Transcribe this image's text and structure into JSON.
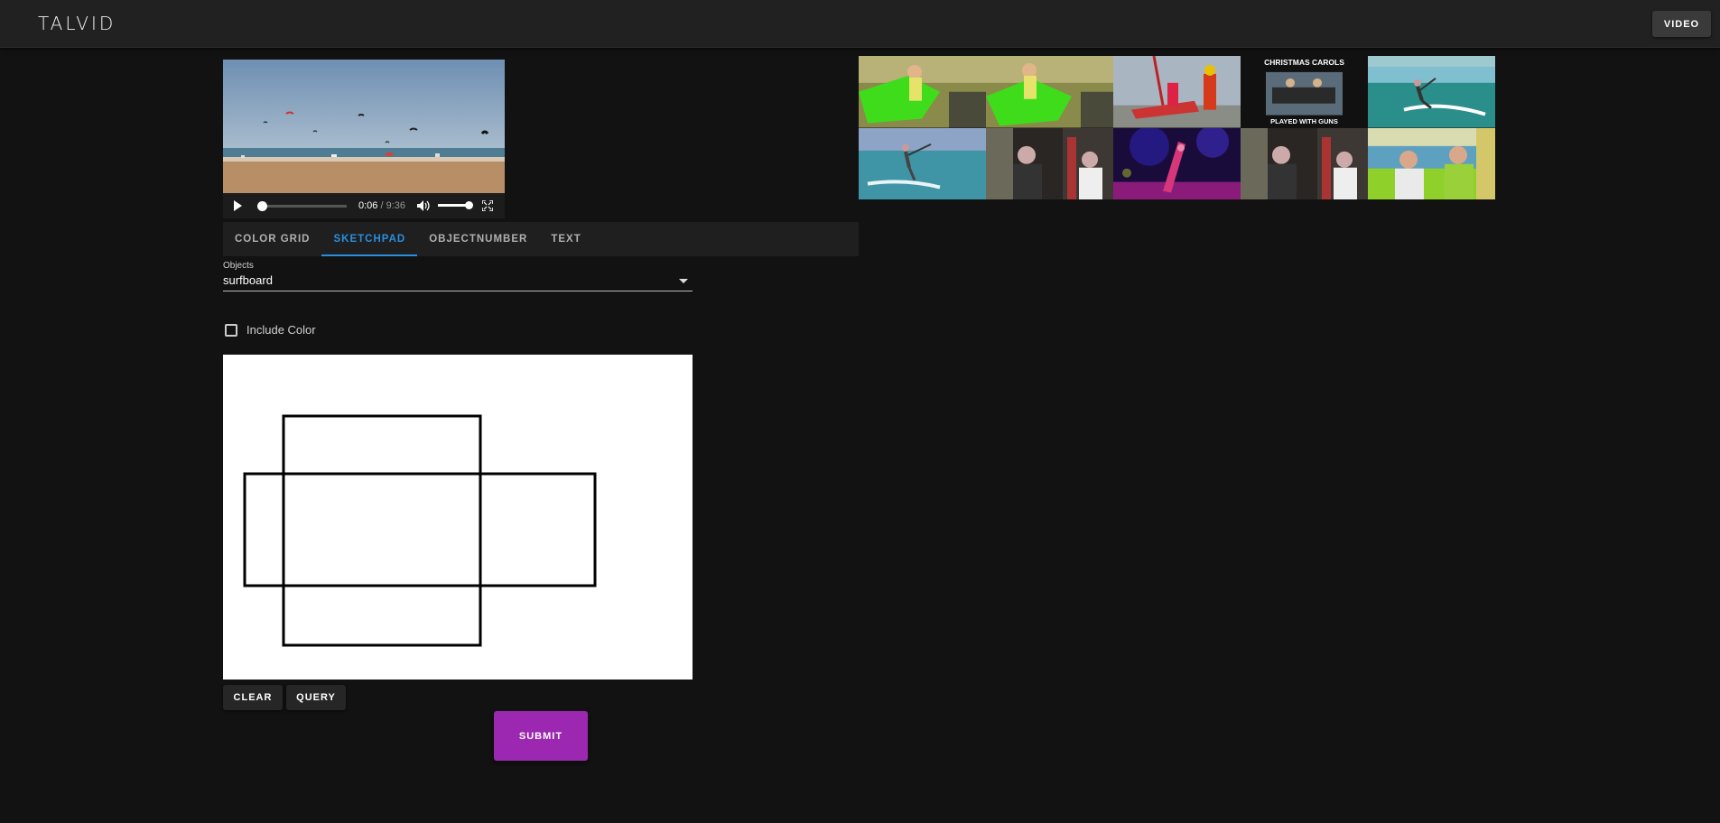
{
  "app": {
    "title": "TALVID"
  },
  "header": {
    "video_button": "VIDEO"
  },
  "player": {
    "current_time": "0:06",
    "duration": "/ 9:36",
    "progress_fraction": 0.011,
    "volume_fraction": 1.0
  },
  "tabs": [
    {
      "label": "COLOR GRID",
      "active": false
    },
    {
      "label": "SKETCHPAD",
      "active": true
    },
    {
      "label": "OBJECTNUMBER",
      "active": false
    },
    {
      "label": "TEXT",
      "active": false
    }
  ],
  "objects": {
    "label": "Objects",
    "selected": "surfboard"
  },
  "include_color": {
    "label": "Include Color",
    "checked": false
  },
  "sketchpad": {
    "shapes": 2
  },
  "buttons": {
    "clear": "CLEAR",
    "query": "QUERY",
    "submit": "SUBMIT"
  },
  "results": {
    "thumbnails": [
      {
        "description": "person with green board indoors"
      },
      {
        "description": "person with green board indoors"
      },
      {
        "description": "rescue workers with stretcher"
      },
      {
        "description": "christmas carols title card",
        "caption_top": "CHRISTMAS CAROLS",
        "caption_bottom": "PLAYED WITH GUNS"
      },
      {
        "description": "kitesurfer on sea"
      },
      {
        "description": "kitesurfer on sea"
      },
      {
        "description": "people seated in a studio"
      },
      {
        "description": "performer on stage with purple lights"
      },
      {
        "description": "people seated in a studio"
      },
      {
        "description": "smiling people outdoors"
      }
    ]
  },
  "colors": {
    "accent": "#2a8ee0",
    "submit": "#9c27b0",
    "background": "#121212",
    "appbar": "#212121"
  }
}
